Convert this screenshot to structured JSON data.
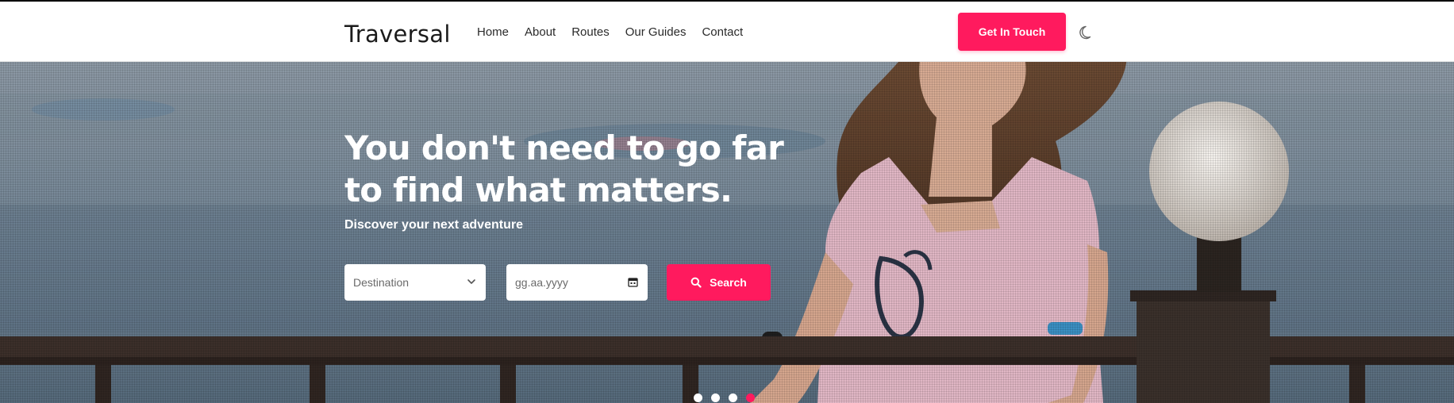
{
  "brand": {
    "name": "Traversal"
  },
  "nav": {
    "items": [
      {
        "label": "Home"
      },
      {
        "label": "About"
      },
      {
        "label": "Routes"
      },
      {
        "label": "Our Guides"
      },
      {
        "label": "Contact"
      }
    ],
    "cta_label": "Get In Touch",
    "theme_toggle_icon": "moon-icon"
  },
  "hero": {
    "headline": "You don't need to go far to find what matters.",
    "subheadline": "Discover your next adventure",
    "search": {
      "destination_selected": "Destination",
      "date_placeholder": "gg.aa.yyyy",
      "button_label": "Search",
      "button_icon": "search-icon",
      "select_icon": "chevron-down-icon",
      "date_icon": "calendar-icon"
    },
    "carousel": {
      "slide_count": 4,
      "active_index": 3
    }
  },
  "colors": {
    "accent": "#ff1a5e",
    "navbar_bg": "#ffffff",
    "text_dark": "#1b1b1b",
    "hero_text": "#ffffff"
  }
}
